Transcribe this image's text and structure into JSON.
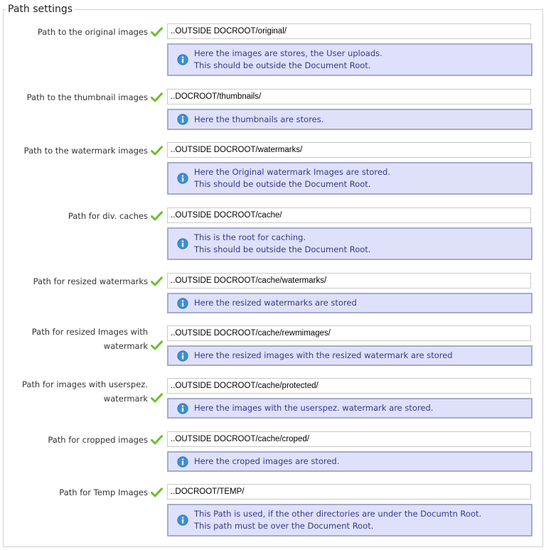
{
  "title": "Path settings",
  "colors": {
    "check": "#6cbf2a",
    "info_bg": "#dfe1fb",
    "info_border": "#a6aacd",
    "info_text": "#353a86",
    "info_icon": "#3d8fd8"
  },
  "settings": [
    {
      "label": "Path to the original images",
      "value": "..OUTSIDE DOCROOT/original/",
      "info": "Here the images are stores, the User uploads.\nThis should be outside the Document Root."
    },
    {
      "label": "Path to the thumbnail images",
      "value": "..DOCROOT/thumbnails/",
      "info": "Here the thumbnails are stores."
    },
    {
      "label": "Path to the watermark images",
      "value": "..OUTSIDE DOCROOT/watermarks/",
      "info": "Here the Original watermark Images are stored.\nThis should be outside the Document Root."
    },
    {
      "label": "Path for div. caches",
      "value": "..OUTSIDE DOCROOT/cache/",
      "info": "This is the root for caching.\nThis should be outside the Document Root."
    },
    {
      "label": "Path for resized watermarks",
      "value": "..OUTSIDE DOCROOT/cache/watermarks/",
      "info": "Here the resized watermarks are stored"
    },
    {
      "label": "Path for resized Images with\nwatermark",
      "value": "..OUTSIDE DOCROOT/cache/rewmimages/",
      "info": "Here the resized images with the resized watermark are stored"
    },
    {
      "label": "Path for images with userspez.\nwatermark",
      "value": "..OUTSIDE DOCROOT/cache/protected/",
      "info": "Here the images with the userspez. watermark are stored."
    },
    {
      "label": "Path for cropped images",
      "value": "..OUTSIDE DOCROOT/cache/croped/",
      "info": "Here the croped images are stored."
    },
    {
      "label": "Path for Temp Images",
      "value": "..DOCROOT/TEMP/",
      "info": "This Path is used, if the other directories are under the Documtn Root.\nThis path must be over the Document Root."
    }
  ]
}
